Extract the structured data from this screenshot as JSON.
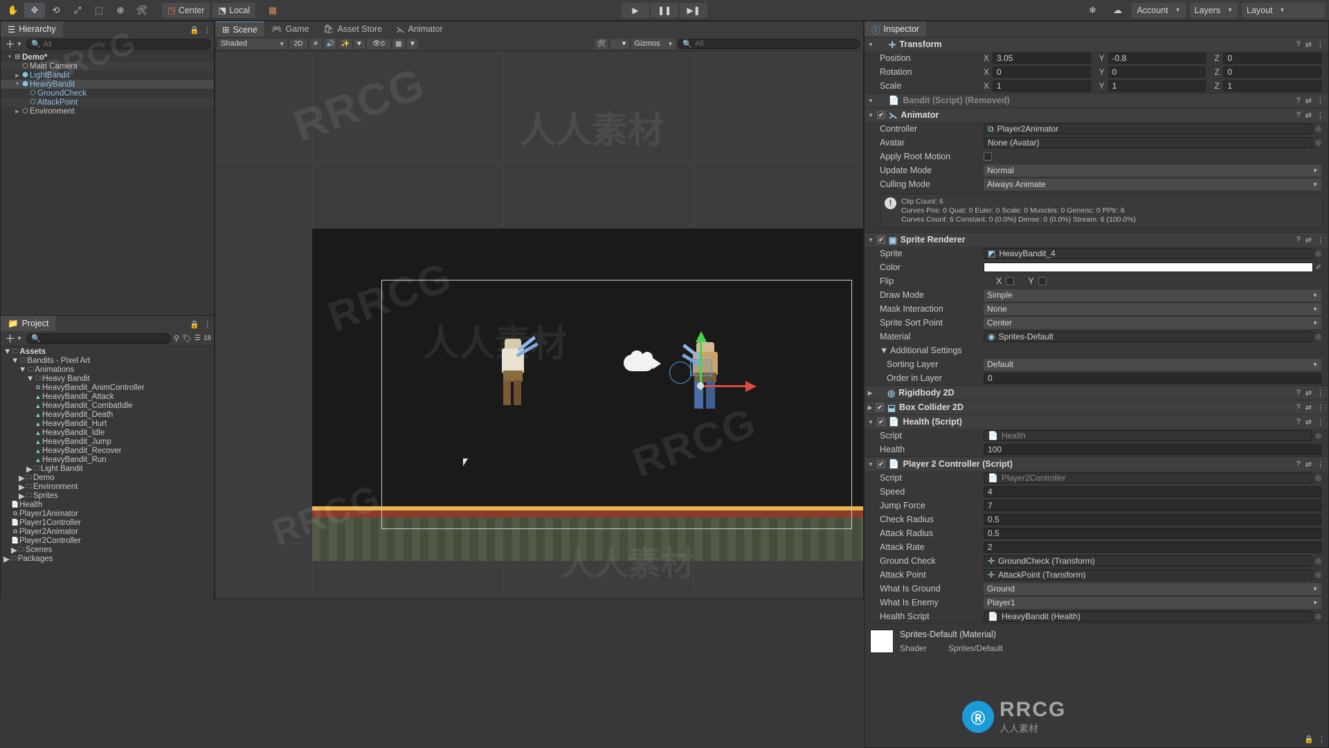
{
  "toolbar": {
    "tools": [
      "hand-tool",
      "move-tool",
      "rotate-tool",
      "scale-tool",
      "rect-tool",
      "transform-tool",
      "custom-tool"
    ],
    "pivot_label": "Center",
    "space_label": "Local",
    "play": "▶",
    "pause": "❚❚",
    "step": "▶❚",
    "collab_label": "",
    "account_label": "Account",
    "layers_label": "Layers",
    "layout_label": "Layout"
  },
  "hierarchy": {
    "tab": "Hierarchy",
    "search_placeholder": "All",
    "items": [
      {
        "label": "Demo*",
        "depth": 0,
        "icon": "scene-icon",
        "arrow": "▼",
        "bold": true,
        "blue": false
      },
      {
        "label": "Main Camera",
        "depth": 1,
        "icon": "gameobject-icon",
        "arrow": "",
        "bold": false,
        "blue": false
      },
      {
        "label": "LightBandit",
        "depth": 1,
        "icon": "prefab-icon",
        "arrow": "▶",
        "bold": false,
        "blue": true
      },
      {
        "label": "HeavyBandit",
        "depth": 1,
        "icon": "prefab-icon",
        "arrow": "▼",
        "bold": false,
        "blue": true
      },
      {
        "label": "GroundCheck",
        "depth": 2,
        "icon": "gameobject-icon",
        "arrow": "",
        "bold": false,
        "blue": true
      },
      {
        "label": "AttackPoint",
        "depth": 2,
        "icon": "gameobject-icon",
        "arrow": "",
        "bold": false,
        "blue": true
      },
      {
        "label": "Environment",
        "depth": 1,
        "icon": "gameobject-icon",
        "arrow": "▶",
        "bold": false,
        "blue": false
      }
    ]
  },
  "project": {
    "tab": "Project",
    "search_placeholder": "",
    "count_badge": "18",
    "items": [
      {
        "label": "Assets",
        "depth": 0,
        "icon": "folder-icon",
        "arrow": "▼",
        "bold": true,
        "green": false
      },
      {
        "label": "Bandits - Pixel Art",
        "depth": 1,
        "icon": "folder-icon",
        "arrow": "▼",
        "bold": false,
        "green": false
      },
      {
        "label": "Animations",
        "depth": 2,
        "icon": "folder-icon",
        "arrow": "▼",
        "bold": false,
        "green": false
      },
      {
        "label": "Heavy Bandit",
        "depth": 3,
        "icon": "folder-icon",
        "arrow": "▼",
        "bold": false,
        "green": false
      },
      {
        "label": "HeavyBandit_AnimController",
        "depth": 4,
        "icon": "animator-controller-icon",
        "arrow": "",
        "bold": false,
        "green": false
      },
      {
        "label": "HeavyBandit_Attack",
        "depth": 4,
        "icon": "animation-clip-icon",
        "arrow": "",
        "bold": false,
        "green": true
      },
      {
        "label": "HeavyBandit_CombatIdle",
        "depth": 4,
        "icon": "animation-clip-icon",
        "arrow": "",
        "bold": false,
        "green": true
      },
      {
        "label": "HeavyBandit_Death",
        "depth": 4,
        "icon": "animation-clip-icon",
        "arrow": "",
        "bold": false,
        "green": true
      },
      {
        "label": "HeavyBandit_Hurt",
        "depth": 4,
        "icon": "animation-clip-icon",
        "arrow": "",
        "bold": false,
        "green": true
      },
      {
        "label": "HeavyBandit_Idle",
        "depth": 4,
        "icon": "animation-clip-icon",
        "arrow": "",
        "bold": false,
        "green": true
      },
      {
        "label": "HeavyBandit_Jump",
        "depth": 4,
        "icon": "animation-clip-icon",
        "arrow": "",
        "bold": false,
        "green": true
      },
      {
        "label": "HeavyBandit_Recover",
        "depth": 4,
        "icon": "animation-clip-icon",
        "arrow": "",
        "bold": false,
        "green": true
      },
      {
        "label": "HeavyBandit_Run",
        "depth": 4,
        "icon": "animation-clip-icon",
        "arrow": "",
        "bold": false,
        "green": true
      },
      {
        "label": "Light Bandit",
        "depth": 3,
        "icon": "folder-icon",
        "arrow": "▶",
        "bold": false,
        "green": false
      },
      {
        "label": "Demo",
        "depth": 2,
        "icon": "folder-icon",
        "arrow": "▶",
        "bold": false,
        "green": false
      },
      {
        "label": "Environment",
        "depth": 2,
        "icon": "folder-icon",
        "arrow": "▶",
        "bold": false,
        "green": false
      },
      {
        "label": "Sprites",
        "depth": 2,
        "icon": "folder-icon",
        "arrow": "▶",
        "bold": false,
        "green": false
      },
      {
        "label": "Health",
        "depth": 1,
        "icon": "script-icon",
        "arrow": "",
        "bold": false,
        "green": false
      },
      {
        "label": "Player1Animator",
        "depth": 1,
        "icon": "animator-controller-icon",
        "arrow": "",
        "bold": false,
        "green": false
      },
      {
        "label": "Player1Controller",
        "depth": 1,
        "icon": "script-icon",
        "arrow": "",
        "bold": false,
        "green": false
      },
      {
        "label": "Player2Animator",
        "depth": 1,
        "icon": "animator-controller-icon",
        "arrow": "",
        "bold": false,
        "green": false
      },
      {
        "label": "Player2Controller",
        "depth": 1,
        "icon": "script-icon",
        "arrow": "",
        "bold": false,
        "green": false
      },
      {
        "label": "Scenes",
        "depth": 1,
        "icon": "folder-icon",
        "arrow": "▶",
        "bold": false,
        "green": false
      },
      {
        "label": "Packages",
        "depth": 0,
        "icon": "folder-icon",
        "arrow": "▶",
        "bold": false,
        "green": false
      }
    ]
  },
  "scene": {
    "tabs": [
      {
        "label": "Scene",
        "icon": "scene-icon",
        "active": true
      },
      {
        "label": "Game",
        "icon": "game-icon",
        "active": false
      },
      {
        "label": "Asset Store",
        "icon": "store-icon",
        "active": false
      },
      {
        "label": "Animator",
        "icon": "animator-icon",
        "active": false
      }
    ],
    "draw_mode": "Shaded",
    "dimension_toggle": "2D",
    "lighting_icon": "lighting-icon",
    "audio_icon": "audio-icon",
    "fx_icon": "fx-icon",
    "hidden_count": "0",
    "grid_icon": "grid-icon",
    "gizmos_label": "Gizmos",
    "search_placeholder": "All"
  },
  "inspector": {
    "tab": "Inspector",
    "components": [
      {
        "name": "Transform",
        "icon": "transform-icon",
        "enabled": null,
        "rows": [
          {
            "label": "Position",
            "type": "vec3",
            "x": "3.05",
            "y": "-0.8",
            "z": "0"
          },
          {
            "label": "Rotation",
            "type": "vec3",
            "x": "0",
            "y": "0",
            "z": "0"
          },
          {
            "label": "Scale",
            "type": "vec3",
            "x": "1",
            "y": "1",
            "z": "1"
          }
        ]
      },
      {
        "name": "Bandit (Script) (Removed)",
        "icon": "script-icon",
        "removed": true,
        "rows": []
      },
      {
        "name": "Animator",
        "icon": "animator-icon",
        "enabled": true,
        "rows": [
          {
            "label": "Controller",
            "type": "object",
            "value": "Player2Animator",
            "objicon": "animator-controller-icon"
          },
          {
            "label": "Avatar",
            "type": "object",
            "value": "None (Avatar)",
            "objicon": ""
          },
          {
            "label": "Apply Root Motion",
            "type": "bool",
            "value": false
          },
          {
            "label": "Update Mode",
            "type": "dropdown",
            "value": "Normal"
          },
          {
            "label": "Culling Mode",
            "type": "dropdown",
            "value": "Always Animate"
          }
        ],
        "info": "Clip Count: 6\nCurves Pos: 0 Quat: 0 Euler: 0 Scale: 0 Muscles: 0 Generic: 0 PPtr: 6\nCurves Count: 6 Constant: 0 (0.0%) Dense: 0 (0.0%) Stream: 6 (100.0%)"
      },
      {
        "name": "Sprite Renderer",
        "icon": "sprite-renderer-icon",
        "enabled": true,
        "rows": [
          {
            "label": "Sprite",
            "type": "object",
            "value": "HeavyBandit_4",
            "objicon": "sprite-icon"
          },
          {
            "label": "Color",
            "type": "color",
            "value": "#FFFFFF"
          },
          {
            "label": "Flip",
            "type": "flip",
            "x": "X",
            "y": "Y"
          },
          {
            "label": "Draw Mode",
            "type": "dropdown",
            "value": "Simple"
          },
          {
            "label": "Mask Interaction",
            "type": "dropdown",
            "value": "None"
          },
          {
            "label": "Sprite Sort Point",
            "type": "dropdown",
            "value": "Center"
          },
          {
            "label": "Material",
            "type": "object",
            "value": "Sprites-Default",
            "objicon": "material-icon"
          },
          {
            "label": "Additional Settings",
            "type": "foldout",
            "value": ""
          },
          {
            "label": "Sorting Layer",
            "type": "dropdown",
            "value": "Default",
            "indent": true
          },
          {
            "label": "Order in Layer",
            "type": "text",
            "value": "0",
            "indent": true
          }
        ]
      },
      {
        "name": "Rigidbody 2D",
        "icon": "rigidbody2d-icon",
        "enabled": null,
        "collapsed": true,
        "rows": []
      },
      {
        "name": "Box Collider 2D",
        "icon": "boxcollider2d-icon",
        "enabled": true,
        "collapsed": true,
        "rows": []
      },
      {
        "name": "Health (Script)",
        "icon": "script-icon",
        "enabled": true,
        "rows": [
          {
            "label": "Script",
            "type": "object",
            "value": "Health",
            "objicon": "script-icon",
            "disabled": true
          },
          {
            "label": "Health",
            "type": "text",
            "value": "100"
          }
        ]
      },
      {
        "name": "Player 2 Controller (Script)",
        "icon": "script-icon",
        "enabled": true,
        "rows": [
          {
            "label": "Script",
            "type": "object",
            "value": "Player2Controller",
            "objicon": "script-icon",
            "disabled": true
          },
          {
            "label": "Speed",
            "type": "text",
            "value": "4"
          },
          {
            "label": "Jump Force",
            "type": "text",
            "value": "7"
          },
          {
            "label": "Check Radius",
            "type": "text",
            "value": "0.5"
          },
          {
            "label": "Attack Radius",
            "type": "text",
            "value": "0.5"
          },
          {
            "label": "Attack Rate",
            "type": "text",
            "value": "2"
          },
          {
            "label": "Ground Check",
            "type": "object",
            "value": "GroundCheck (Transform)",
            "objicon": "transform-icon"
          },
          {
            "label": "Attack Point",
            "type": "object",
            "value": "AttackPoint (Transform)",
            "objicon": "transform-icon"
          },
          {
            "label": "What Is Ground",
            "type": "dropdown",
            "value": "Ground"
          },
          {
            "label": "What Is Enemy",
            "type": "dropdown",
            "value": "Player1"
          },
          {
            "label": "Health Script",
            "type": "object",
            "value": "HeavyBandit (Health)",
            "objicon": "script-icon"
          }
        ]
      }
    ],
    "material_preview": {
      "title": "Sprites-Default (Material)",
      "shader_label": "Shader",
      "shader_value": "Sprites/Default"
    }
  },
  "watermarks": {
    "text_en": "RRCG",
    "text_cn": "人人素材",
    "brand": "RRCG"
  }
}
